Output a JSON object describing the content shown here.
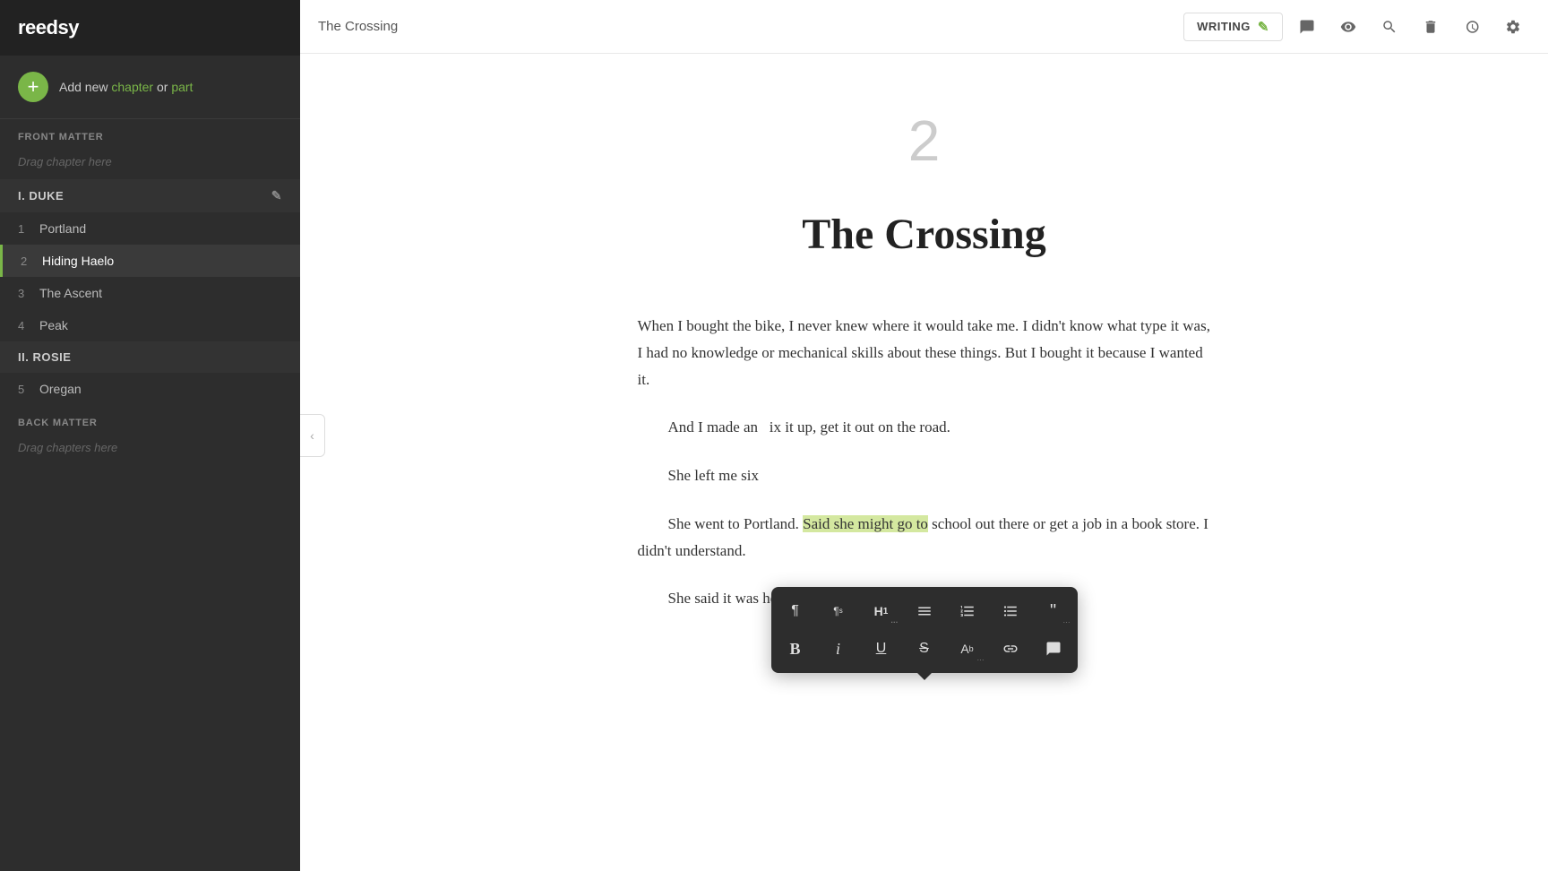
{
  "app": {
    "name": "reedsy"
  },
  "sidebar": {
    "add_new_prefix": "Add new ",
    "add_new_chapter": "chapter",
    "add_new_or": " or ",
    "add_new_part": "part",
    "front_matter_label": "FRONT MATTER",
    "front_matter_placeholder": "Drag chapter here",
    "parts": [
      {
        "id": "part-duke",
        "label": "I. DUKE",
        "chapters": [
          {
            "num": "1",
            "title": "Portland",
            "active": false
          },
          {
            "num": "2",
            "title": "Hiding Haelo",
            "active": true
          },
          {
            "num": "3",
            "title": "The Ascent",
            "active": false
          },
          {
            "num": "4",
            "title": "Peak",
            "active": false
          }
        ]
      },
      {
        "id": "part-rosie",
        "label": "II. ROSIE",
        "chapters": [
          {
            "num": "5",
            "title": "Oregan",
            "active": false
          }
        ]
      }
    ],
    "back_matter_label": "BACK MATTER",
    "back_matter_placeholder": "Drag chapters here"
  },
  "topbar": {
    "chapter_title": "The Crossing",
    "writing_mode": "WRITING",
    "icons": {
      "pencil": "✎",
      "comment": "💬",
      "eye": "👁",
      "search": "🔍",
      "trash": "🗑",
      "history": "🕐",
      "settings": "⚙"
    }
  },
  "content": {
    "chapter_number": "2",
    "chapter_title": "The Crossing",
    "paragraphs": [
      {
        "indented": false,
        "text": "When I bought the bike, I never knew where it would take me. I didn't know what type it was, I had no knowledge or mechanical skills about these things. But I bought it because I wanted it."
      },
      {
        "indented": true,
        "text": "And I made an  ix it up, get it out on the road.",
        "has_truncation": true
      },
      {
        "indented": true,
        "text": "She left me six",
        "has_truncation": true
      },
      {
        "indented": true,
        "text_before": "She went to Portland. ",
        "highlight": "Said she might go to",
        "text_after": " school out there or get a job in a book store. I didn't understand.",
        "has_highlight": true
      },
      {
        "indented": true,
        "text": "She said it was her calling. Something was pulling her there. She"
      }
    ]
  },
  "format_toolbar": {
    "row1": [
      {
        "icon": "¶",
        "label": "paragraph",
        "badge": ""
      },
      {
        "icon": "¶s",
        "label": "paragraph-sans",
        "badge": "",
        "small": true
      },
      {
        "icon": "H1",
        "label": "heading1",
        "badge": "···"
      },
      {
        "icon": "≡",
        "label": "align",
        "badge": ""
      },
      {
        "icon": "≡1",
        "label": "ordered-list",
        "badge": ""
      },
      {
        "icon": "≡•",
        "label": "bullet-list",
        "badge": ""
      },
      {
        "icon": "❝",
        "label": "blockquote",
        "badge": "···"
      }
    ],
    "row2": [
      {
        "icon": "B",
        "label": "bold",
        "bold": true
      },
      {
        "icon": "I",
        "label": "italic",
        "italic": true
      },
      {
        "icon": "U",
        "label": "underline",
        "underline": true
      },
      {
        "icon": "S",
        "label": "strikethrough",
        "strike": true
      },
      {
        "icon": "Aᵇ",
        "label": "font-size"
      },
      {
        "icon": "🔗",
        "label": "link"
      },
      {
        "icon": "💬",
        "label": "comment"
      }
    ]
  }
}
